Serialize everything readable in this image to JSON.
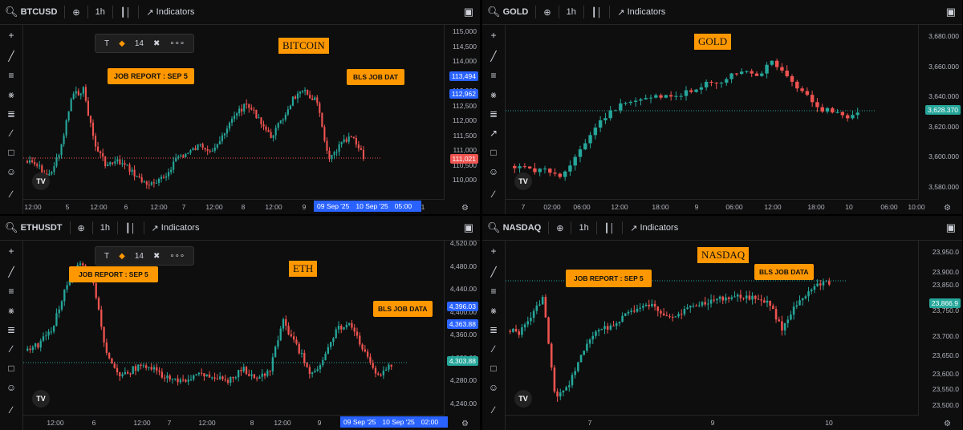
{
  "colors": {
    "up": "#26a69a",
    "down": "#ef5350",
    "accent": "#ff9800",
    "blue": "#2962ff",
    "bg": "#0e0e0e"
  },
  "common": {
    "timeframe": "1h",
    "indicators_label": "Indicators"
  },
  "panes": [
    {
      "symbol": "BTCUSD",
      "title": "BITCOIN",
      "float_toolbar": {
        "font_size": "14",
        "more": "∘∘∘"
      },
      "callouts": [
        "JOB REPORT : SEP 5",
        "BLS JOB DAT"
      ],
      "y_ticks": [
        "115,000",
        "114,500",
        "114,000",
        "113,500",
        "113,000",
        "112,500",
        "112,000",
        "111,500",
        "111,000",
        "110,500",
        "110,000"
      ],
      "x_ticks": [
        "12:00",
        "5",
        "12:00",
        "6",
        "12:00",
        "7",
        "12:00",
        "8",
        "12:00",
        "9",
        "11"
      ],
      "x_highlight": [
        "09 Sep '25",
        "10 Sep '25",
        "05:00"
      ],
      "price_labels": [
        {
          "v": "113,494",
          "c": "#2962ff"
        },
        {
          "v": "112,962",
          "c": "#2962ff"
        },
        {
          "v": "111,021",
          "c": "#ef5350"
        }
      ]
    },
    {
      "symbol": "GOLD",
      "title": "GOLD",
      "callouts": [],
      "y_ticks": [
        "3,680.000",
        "3,660.000",
        "3,640.000",
        "3,620.000",
        "3,600.000",
        "3,580.000"
      ],
      "x_ticks": [
        "7",
        "02:00",
        "06:00",
        "12:00",
        "18:00",
        "9",
        "06:00",
        "12:00",
        "18:00",
        "10",
        "06:00",
        "10:00"
      ],
      "x_highlight": [],
      "price_labels": [
        {
          "v": "3,628.370",
          "c": "#26a69a"
        }
      ]
    },
    {
      "symbol": "ETHUSDT",
      "title": "ETH",
      "float_toolbar": {
        "font_size": "14",
        "more": "∘∘∘"
      },
      "callouts": [
        "JOB REPORT : SEP 5",
        "BLS JOB DATA"
      ],
      "y_ticks": [
        "4,520.00",
        "4,480.00",
        "4,440.00",
        "4,400.00",
        "4,360.00",
        "4,320.00",
        "4,280.00",
        "4,240.00"
      ],
      "x_ticks": [
        "12:00",
        "6",
        "12:00",
        "7",
        "12:00",
        "8",
        "12:00",
        "9",
        "2:00"
      ],
      "x_highlight": [
        "09 Sep '25",
        "10 Sep '25",
        "02:00"
      ],
      "price_labels": [
        {
          "v": "4,396.03",
          "c": "#2962ff"
        },
        {
          "v": "4,363.88",
          "c": "#2962ff"
        },
        {
          "v": "4,303.88",
          "c": "#26a69a"
        }
      ]
    },
    {
      "symbol": "NASDAQ",
      "title": "NASDAQ",
      "callouts": [
        "JOB REPORT : SEP 5",
        "BLS JOB DATA"
      ],
      "y_ticks": [
        "23,950.0",
        "23,900.0",
        "23,850.0",
        "23,750.0",
        "23,700.0",
        "23,650.0",
        "23,600.0",
        "23,550.0",
        "23,500.0"
      ],
      "x_ticks": [
        "7",
        "9",
        "10"
      ],
      "x_highlight": [],
      "price_labels": [
        {
          "v": "23,866.9",
          "c": "#26a69a"
        }
      ]
    }
  ]
}
